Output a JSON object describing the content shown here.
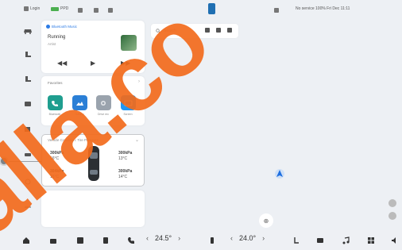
{
  "status_bar": {
    "left_label": "Login",
    "badge_label": "PPD",
    "right_text": "No service 100% Fri Dec 11:11"
  },
  "rail": {
    "items": [
      "car-icon",
      "seat-icon",
      "seat-rear-icon",
      "window-icon",
      "light-icon",
      "defrost-icon",
      "fan-icon",
      "vent-icon"
    ]
  },
  "media": {
    "source": "Bluetooth Music",
    "title": "Running",
    "artist": "Artist",
    "controls": [
      "◀◀",
      "▶",
      "▶▶"
    ]
  },
  "favorites": {
    "header": "Favorites",
    "apps": [
      {
        "label": "Bluetooth",
        "color": "#1f9e8f",
        "icon": "phone-icon"
      },
      {
        "label": "Gallery",
        "color": "#2b7fd6",
        "icon": "image-icon"
      },
      {
        "label": "Drive rec",
        "color": "#9aa3ad",
        "icon": "camera-icon"
      },
      {
        "label": "Screen",
        "color": "#2196f3",
        "icon": "screen-icon"
      }
    ]
  },
  "vehicle": {
    "header": "Vehicle Condition: Tire Pressure",
    "tires": {
      "front_left": {
        "pressure": "300kPa",
        "temp": "16°C"
      },
      "front_right": {
        "pressure": "300kPa",
        "temp": "13°C"
      },
      "rear_left": {
        "pressure": "304kPa",
        "temp": "16°C"
      },
      "rear_right": {
        "pressure": "300kPa",
        "temp": "14°C"
      }
    }
  },
  "map": {
    "search_placeholder": "Search"
  },
  "dock": {
    "left_temp": "24.5°",
    "right_temp": "24.0°"
  },
  "watermark": "alla.co",
  "colors": {
    "accent": "#2c7be5",
    "watermark": "#f26a1b",
    "vehicle_border": "#c7c9cc"
  }
}
